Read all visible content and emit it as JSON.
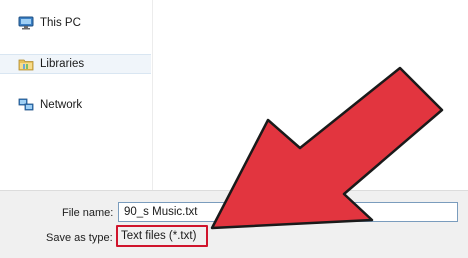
{
  "nav": {
    "items": [
      {
        "label": "This PC",
        "icon": "computer-icon"
      },
      {
        "label": "Libraries",
        "icon": "libraries-icon"
      },
      {
        "label": "Network",
        "icon": "network-icon"
      }
    ]
  },
  "save_bar": {
    "file_name_label": "File name:",
    "file_name_value": "90_s Music.txt",
    "save_as_type_label": "Save as type:",
    "save_as_type_value": "Text files (*.txt)"
  },
  "colors": {
    "arrow_fill": "#e2353f",
    "arrow_outline": "#1a1a1a",
    "highlight_border": "#d0142c",
    "selected_nav_bg": "#f0f5fa"
  },
  "annotations": {
    "arrow": "red-arrow-pointer",
    "highlight": "red-highlight-box"
  }
}
